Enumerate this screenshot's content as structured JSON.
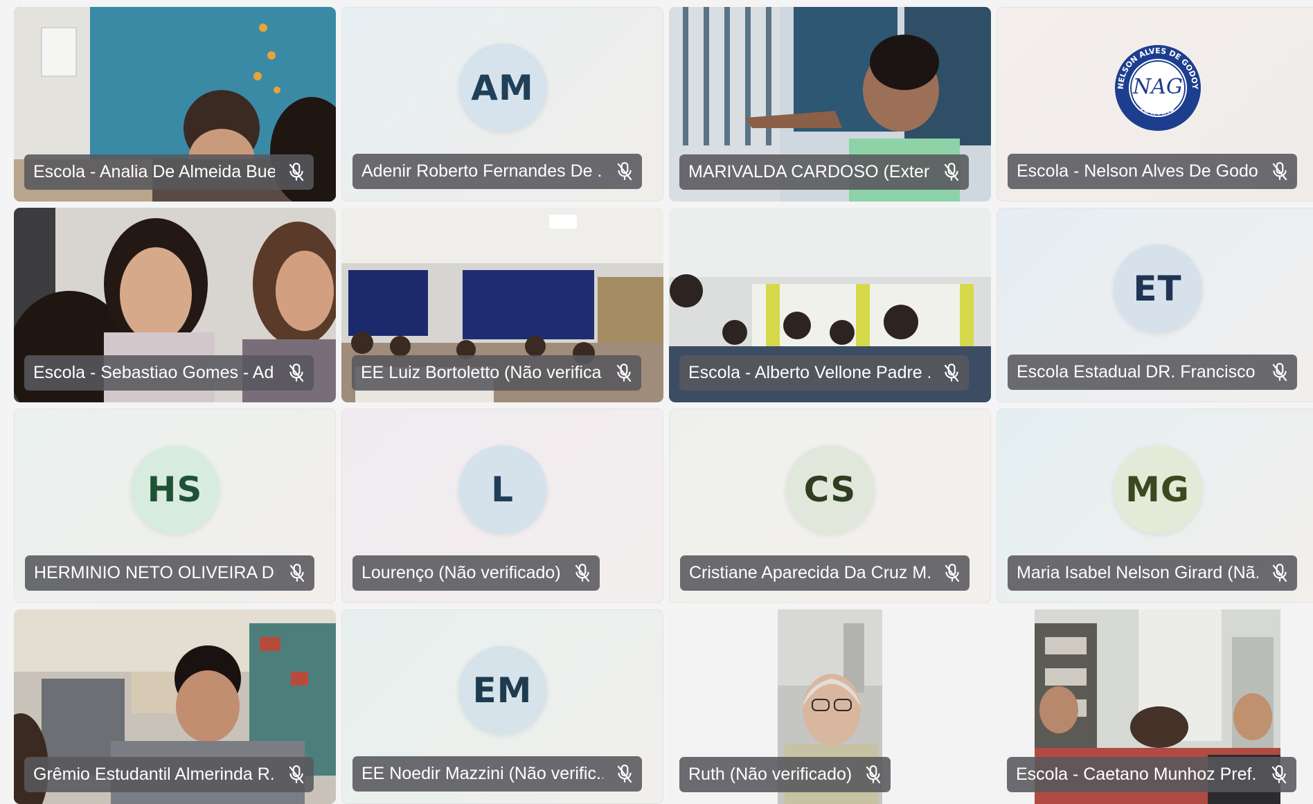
{
  "participants": [
    {
      "name": "Escola - Analia De Almeida Bue...",
      "type": "video",
      "scene": "classroom-blue-wall",
      "muted": true
    },
    {
      "name": "Adenir Roberto Fernandes De ...",
      "type": "avatar",
      "initials": "AM",
      "avatar_bg": "#d6e3ec",
      "initials_color": "#1f4058",
      "muted": true
    },
    {
      "name": "MARIVALDA CARDOSO (Extern...",
      "type": "video",
      "scene": "teacher-window",
      "muted": true
    },
    {
      "name": "Escola - Nelson Alves De Godo...",
      "type": "logo",
      "logo": {
        "top": "NELSON ALVES DE GODOY",
        "left": "E.E.DR",
        "center": "NAG",
        "bottom": "AMPARO"
      },
      "muted": true
    },
    {
      "name": "Escola - Sebastiao Gomes - Ad...",
      "type": "video",
      "scene": "students-closeup",
      "muted": true
    },
    {
      "name": "EE Luiz Bortoletto (Não verifica...",
      "type": "video",
      "scene": "classroom-blue-curtains",
      "muted": true
    },
    {
      "name": "Escola - Alberto Vellone Padre ...",
      "type": "video",
      "scene": "classroom-students-window",
      "muted": true
    },
    {
      "name": "Escola Estadual DR. Francisco T...",
      "type": "avatar",
      "initials": "ET",
      "avatar_bg": "#d6e1ec",
      "initials_color": "#1f3552",
      "muted": true
    },
    {
      "name": "HERMINIO NETO OLIVEIRA DE ...",
      "type": "avatar",
      "initials": "HS",
      "avatar_bg": "#d7ecdf",
      "initials_color": "#1f5234",
      "muted": true
    },
    {
      "name": "Lourenço (Não verificado)",
      "type": "avatar",
      "initials": "L",
      "avatar_bg": "#d5e2ec",
      "initials_color": "#223d57",
      "muted": true
    },
    {
      "name": "Cristiane Aparecida Da Cruz M...",
      "type": "avatar",
      "initials": "CS",
      "avatar_bg": "#e2e7dc",
      "initials_color": "#2f3d20",
      "muted": true
    },
    {
      "name": "Maria Isabel Nelson Girard (Nã...",
      "type": "avatar",
      "initials": "MG",
      "avatar_bg": "#e3ead8",
      "initials_color": "#3a4a1e",
      "muted": true
    },
    {
      "name": "Grêmio Estudantil Almerinda R...",
      "type": "video",
      "scene": "student-shelves",
      "muted": true
    },
    {
      "name": "EE Noedir Mazzini (Não verific...",
      "type": "avatar",
      "initials": "EM",
      "avatar_bg": "#d6e3ea",
      "initials_color": "#1f3b4f",
      "muted": true
    },
    {
      "name": "Ruth (Não verificado)",
      "type": "narrow-video",
      "scene": "woman-glasses",
      "muted": true
    },
    {
      "name": "Escola - Caetano Munhoz Pref...",
      "type": "narrow-video",
      "scene": "students-room",
      "muted": true
    }
  ]
}
